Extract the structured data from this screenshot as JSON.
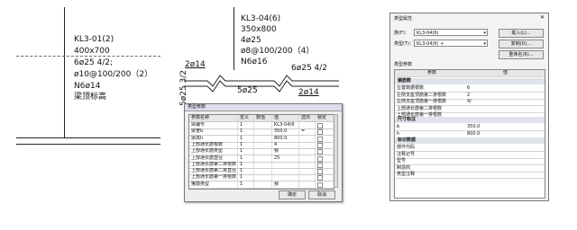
{
  "panel1": {
    "beam_id": "KL3-01(2)",
    "section": "400x700",
    "top_bars": "6ø25 4/2;",
    "stirrup": "ø10@100/200（2）",
    "waist_bars": "N6ø14",
    "note": "梁顶标高"
  },
  "panel2": {
    "beam_id": "KL3-04(6)",
    "section": "350x800",
    "top_bars": "4ø25",
    "stirrup": "ø8@100/200（4）",
    "waist_bars": "N6ø16",
    "left_support": "2ø14",
    "left_vertical": "5ø25 3/2",
    "bottom_bars": "5ø25",
    "right_support": "6ø25 4/2",
    "right_bottom": "2ø14",
    "dialog": {
      "title": "类型参数",
      "headers": [
        "参数名称",
        "定义",
        "数值",
        "值",
        "选项",
        "锁定"
      ],
      "rows": [
        [
          "梁编号",
          "1",
          "",
          "KL3-04(6",
          "",
          ""
        ],
        [
          "梁宽b",
          "1",
          "",
          "350.0",
          "=",
          ""
        ],
        [
          "梁高h",
          "1",
          "",
          "800.0",
          "",
          ""
        ],
        [
          "上部通长筋根数",
          "1",
          "",
          "4",
          "",
          ""
        ],
        [
          "上部通长筋类型",
          "1",
          "",
          "我",
          "",
          ""
        ],
        [
          "上部通长筋直径",
          "1",
          "",
          "25",
          "",
          ""
        ],
        [
          "上部通长筋第二排根数",
          "1",
          "",
          "",
          "",
          ""
        ],
        [
          "上部通长筋第二排直径",
          "1",
          "",
          "",
          "",
          ""
        ],
        [
          "上部通长筋第一排根数",
          "1",
          "",
          "",
          "",
          ""
        ],
        [
          "箍筋类型",
          "1",
          "",
          "我",
          "",
          ""
        ]
      ],
      "ok": "确定",
      "cancel": "取消"
    }
  },
  "panel3": {
    "title": "类型属性",
    "family_label": "族(F)：",
    "family_value": "KL3-04(6)",
    "type_label": "类型(T)：",
    "type_value": "KL3-04(6) +",
    "btn_load": "载入(L)...",
    "btn_duplicate": "复制(D)...",
    "btn_rename": "重命名(R)...",
    "type_params_label": "类型参数",
    "col_param": "参数",
    "col_value": "值",
    "section_rebar": "钢筋数",
    "rebar_rows": [
      {
        "name": "位置数据根数",
        "value": "6"
      },
      {
        "name": "左侧支座顶筋第二排根数",
        "value": "2"
      },
      {
        "name": "左侧支座顶筋第一排根数",
        "value": "4/"
      },
      {
        "name": "上部通长筋第二排根数",
        "value": ""
      },
      {
        "name": "上部通长筋第一排根数",
        "value": ""
      }
    ],
    "section_dims": "尺寸标注",
    "dims_rows": [
      {
        "name": "b",
        "value": "350.0"
      },
      {
        "name": "h",
        "value": "800.0"
      }
    ],
    "section_id": "标识数据",
    "id_rows": [
      {
        "name": "部件代码",
        "value": ""
      },
      {
        "name": "注释记号",
        "value": ""
      },
      {
        "name": "型号",
        "value": ""
      },
      {
        "name": "制造商",
        "value": ""
      },
      {
        "name": "类型注释",
        "value": ""
      }
    ]
  }
}
